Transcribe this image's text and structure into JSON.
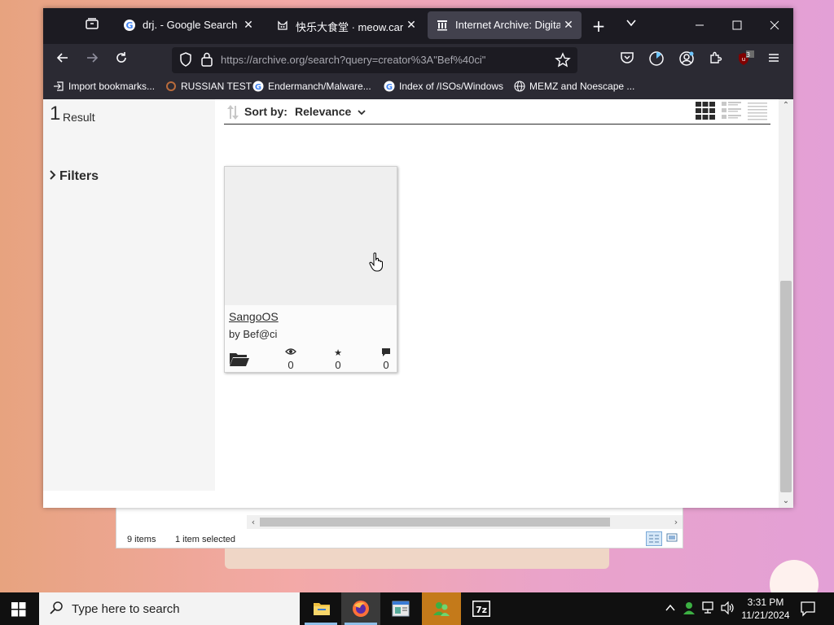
{
  "browser": {
    "tabs": [
      {
        "title": "drj. - Google Search",
        "favicon": "google-icon",
        "active": false
      },
      {
        "title": "快乐大食堂 · meow.came",
        "favicon": "cat-icon",
        "active": false
      },
      {
        "title": "Internet Archive: Digital L",
        "favicon": "archive-icon",
        "active": true
      }
    ],
    "url": "https://archive.org/search?query=creator%3A\"Bef%40ci\"",
    "extension_badge": "3",
    "bookmarks": [
      {
        "label": "Import bookmarks...",
        "icon": "import-icon"
      },
      {
        "label": "RUSSIAN TEST",
        "icon": "search-ring-icon"
      },
      {
        "label": "Endermanch/Malware...",
        "icon": "google-icon"
      },
      {
        "label": "Index of /ISOs/Windows",
        "icon": "google-icon"
      },
      {
        "label": "MEMZ and Noescape ...",
        "icon": "globe-icon"
      }
    ]
  },
  "page": {
    "result_count": "1",
    "result_label": "Result",
    "filters_label": "Filters",
    "sort_label": "Sort by:",
    "sort_value": "Relevance",
    "items": [
      {
        "title": "SangoOS",
        "creator": "by Bef@ci",
        "views": "0",
        "favorites": "0",
        "reviews": "0",
        "media_icon": "folder-icon"
      }
    ]
  },
  "explorer": {
    "item_count": "9 items",
    "selection": "1 item selected"
  },
  "taskbar": {
    "search_placeholder": "Type here to search",
    "time": "3:31 PM",
    "date": "11/21/2024"
  }
}
